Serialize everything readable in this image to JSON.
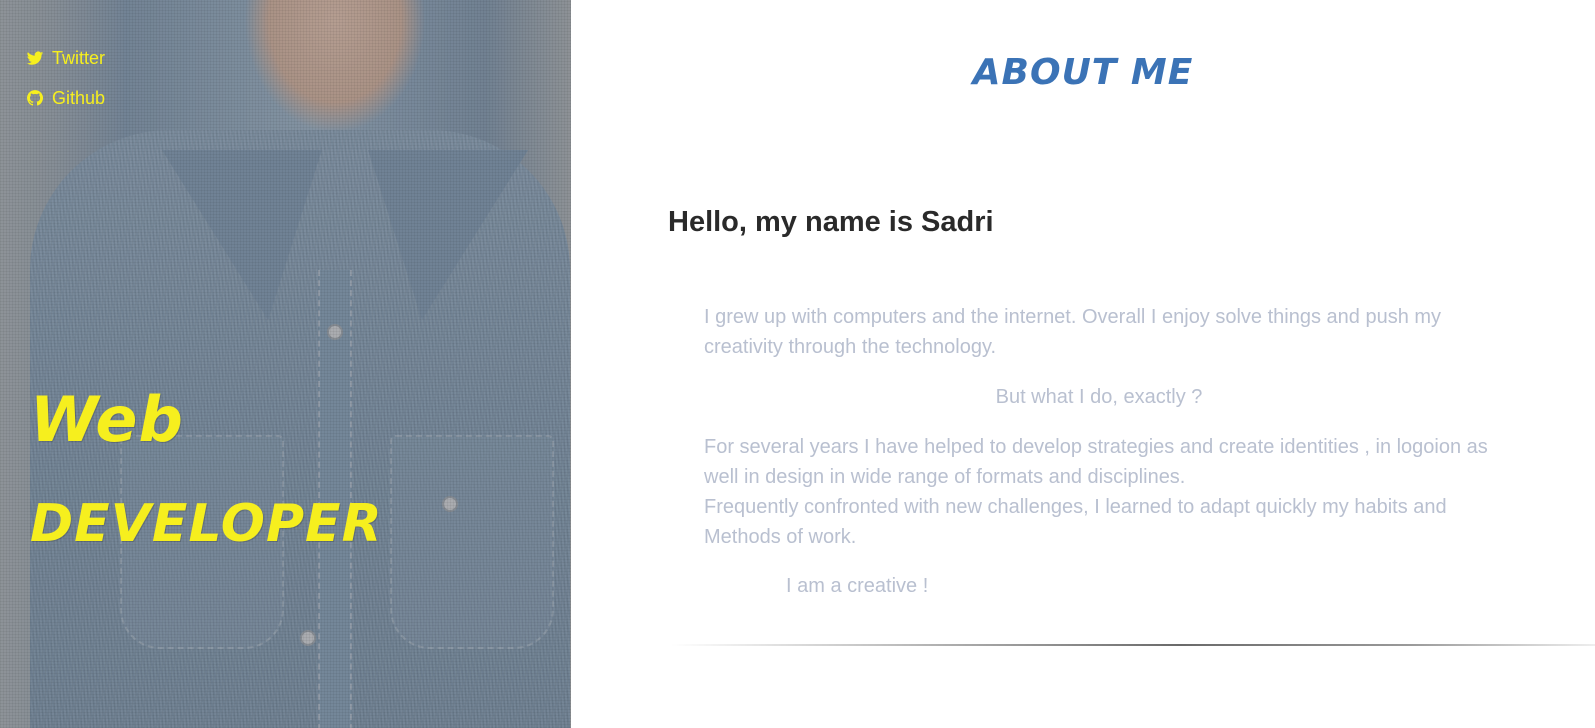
{
  "sidebar": {
    "social": [
      {
        "label": "Twitter",
        "icon": "twitter-icon"
      },
      {
        "label": "Github",
        "icon": "github-icon"
      }
    ],
    "headline": {
      "line1": "Web",
      "line2": "developer"
    }
  },
  "main": {
    "section_title": "About me",
    "greeting": "Hello, my name is Sadri",
    "paragraphs": {
      "intro": "I grew up with computers and the internet. Overall I enjoy solve things and push my creativity through the technology.",
      "question": "But what I do, exactly ?",
      "experience_1": "For several years I have helped to develop strategies and create identities , in logoion as well in design in wide range of formats and disciplines.",
      "experience_2": "Frequently confronted with new challenges, I learned to adapt quickly my habits and Methods of work.",
      "closing": "I am a creative !"
    }
  },
  "colors": {
    "accent_yellow": "#f6ef1e",
    "title_blue": "#3b73b6",
    "body_text": "#b9c0d0",
    "heading_text": "#2a2a2a"
  }
}
